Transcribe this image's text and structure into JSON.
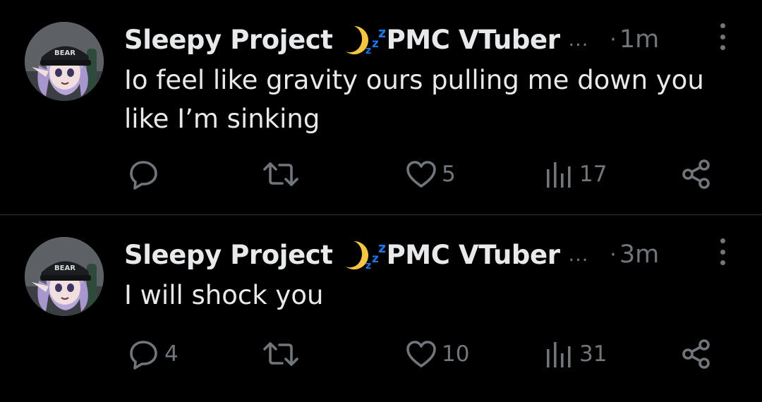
{
  "tweets": [
    {
      "name": "Sleepy Project",
      "name_suffix": "PMC VTuber",
      "ellipsis": "...",
      "dot": "·",
      "time": "1m",
      "text": "Io feel like gravity ours pulling me down you like I’m sinking",
      "reply_count": "",
      "retweet_count": "",
      "like_count": "5",
      "view_count": "17"
    },
    {
      "name": "Sleepy Project",
      "name_suffix": "PMC VTuber",
      "ellipsis": "...",
      "dot": "·",
      "time": "3m",
      "text": "I will shock you",
      "reply_count": "4",
      "retweet_count": "",
      "like_count": "10",
      "view_count": "31"
    }
  ],
  "avatar": {
    "cap_text": "BEAR"
  },
  "icons": {
    "name_emoji": "crescent-moon-zzz-icon",
    "more": "more-vertical-icon",
    "reply": "reply-bubble-icon",
    "retweet": "retweet-icon",
    "like": "heart-icon",
    "views": "views-bar-chart-icon",
    "share": "share-icon"
  },
  "colors": {
    "background": "#000000",
    "primary_text": "#e7e9ea",
    "secondary_text": "#71767b",
    "divider": "#2f3336",
    "moon": "#f4c542",
    "zzz": "#1d75e6"
  }
}
